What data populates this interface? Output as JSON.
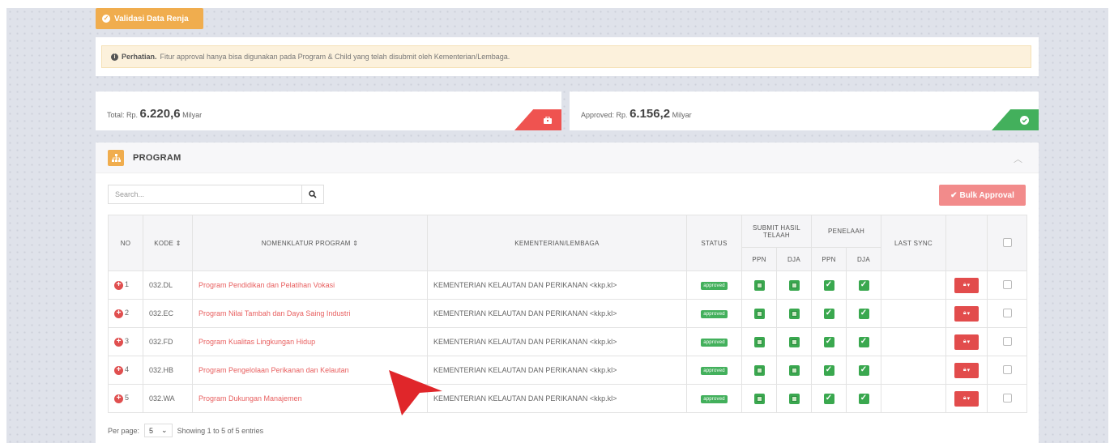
{
  "validasi_button": "Validasi Data Renja",
  "alert": {
    "strong": "Perhatian.",
    "text": "Fitur approval hanya bisa digunakan pada Program & Child yang telah disubmit oleh Kementerian/Lembaga."
  },
  "totals": {
    "total_label": "Total: Rp.",
    "total_value": "6.220,6",
    "total_unit": "Milyar",
    "approved_label": "Approved: Rp.",
    "approved_value": "6.156,2",
    "approved_unit": "Milyar"
  },
  "panel": {
    "title": "PROGRAM"
  },
  "search": {
    "placeholder": "Search..."
  },
  "bulk_button": "Bulk Approval",
  "table": {
    "headers": {
      "no": "NO",
      "kode": "KODE ⇕",
      "nomenklatur": "NOMENKLATUR PROGRAM ⇕",
      "kementerian": "KEMENTERIAN/LEMBAGA",
      "status": "STATUS",
      "submit": "SUBMIT HASIL TELAAH",
      "penelaah": "PENELAAH",
      "ppn": "PPN",
      "dja": "DJA",
      "last_sync": "LAST SYNC"
    },
    "rows": [
      {
        "no": "1",
        "kode": "032.DL",
        "program": "Program Pendidikan dan Pelatihan Vokasi",
        "kementerian": "KEMENTERIAN KELAUTAN DAN PERIKANAN <kkp.kl>",
        "status": "approved"
      },
      {
        "no": "2",
        "kode": "032.EC",
        "program": "Program Nilai Tambah dan Daya Saing Industri",
        "kementerian": "KEMENTERIAN KELAUTAN DAN PERIKANAN <kkp.kl>",
        "status": "approved"
      },
      {
        "no": "3",
        "kode": "032.FD",
        "program": "Program Kualitas Lingkungan Hidup",
        "kementerian": "KEMENTERIAN KELAUTAN DAN PERIKANAN <kkp.kl>",
        "status": "approved"
      },
      {
        "no": "4",
        "kode": "032.HB",
        "program": "Program Pengelolaan Perikanan dan Kelautan",
        "kementerian": "KEMENTERIAN KELAUTAN DAN PERIKANAN <kkp.kl>",
        "status": "approved"
      },
      {
        "no": "5",
        "kode": "032.WA",
        "program": "Program Dukungan Manajemen",
        "kementerian": "KEMENTERIAN KELAUTAN DAN PERIKANAN <kkp.kl>",
        "status": "approved"
      }
    ]
  },
  "footer": {
    "per_page_label": "Per page:",
    "per_page_value": "5",
    "showing": "Showing 1 to 5 of 5 entries"
  },
  "colors": {
    "orange": "#f0ad4e",
    "red": "#e24c4c",
    "green": "#43b05c",
    "link": "#e86060"
  }
}
